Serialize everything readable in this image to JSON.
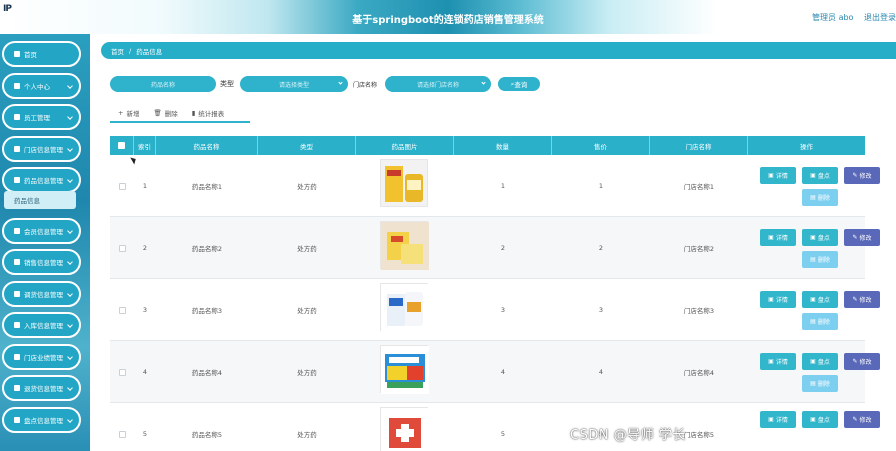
{
  "header": {
    "logo": "IP",
    "title": "基于springboot的连锁药店销售管理系统",
    "user_label": "管理员 abo",
    "logout_label": "退出登录"
  },
  "sidebar": {
    "items": [
      {
        "label": "首页",
        "icon": "home-icon"
      },
      {
        "label": "个人中心",
        "icon": "user-icon"
      },
      {
        "label": "员工管理",
        "icon": "staff-icon"
      },
      {
        "label": "门店信息管理",
        "icon": "store-icon"
      },
      {
        "label": "药品信息管理",
        "icon": "grid-icon"
      },
      {
        "label": "会员信息管理",
        "icon": "grid-icon"
      },
      {
        "label": "销售信息管理",
        "icon": "grid-icon"
      },
      {
        "label": "调货信息管理",
        "icon": "box-icon"
      },
      {
        "label": "入库信息管理",
        "icon": "location-icon"
      },
      {
        "label": "门店业绩管理",
        "icon": "grid-icon"
      },
      {
        "label": "退货信息管理",
        "icon": "box-icon"
      },
      {
        "label": "盘点信息管理",
        "icon": "grid-icon"
      }
    ],
    "active_sub": "药品信息"
  },
  "breadcrumb": {
    "home": "首页",
    "sep": "/",
    "current": "药品信息"
  },
  "search": {
    "name_placeholder": "药品名称",
    "type_label": "类型",
    "type_placeholder": "请选择类型",
    "store_label": "门店名称",
    "store_placeholder": "请选择门店名称",
    "button": "查询"
  },
  "actions": {
    "add": "新增",
    "delete": "删除",
    "stats": "统计报表"
  },
  "table": {
    "headers": [
      "索引",
      "药品名称",
      "类型",
      "药品图片",
      "数量",
      "售价",
      "门店名称",
      "操作"
    ],
    "rows": [
      {
        "index": "1",
        "name": "药品名称1",
        "type": "处方药",
        "qty": "1",
        "price": "1",
        "store": "门店名称1"
      },
      {
        "index": "2",
        "name": "药品名称2",
        "type": "处方药",
        "qty": "2",
        "price": "2",
        "store": "门店名称2"
      },
      {
        "index": "3",
        "name": "药品名称3",
        "type": "处方药",
        "qty": "3",
        "price": "3",
        "store": "门店名称3"
      },
      {
        "index": "4",
        "name": "药品名称4",
        "type": "处方药",
        "qty": "4",
        "price": "4",
        "store": "门店名称4"
      },
      {
        "index": "5",
        "name": "药品名称5",
        "type": "处方药",
        "qty": "5",
        "price": "5",
        "store": "门店名称5"
      }
    ],
    "buttons": {
      "detail": "详情",
      "check": "盘点",
      "edit": "修改",
      "delete": "删除"
    }
  },
  "watermark": "CSDN @导师 学长",
  "colors": {
    "accent": "#2bb0ca",
    "edit": "#5968b8",
    "delete": "#7dcff0"
  }
}
